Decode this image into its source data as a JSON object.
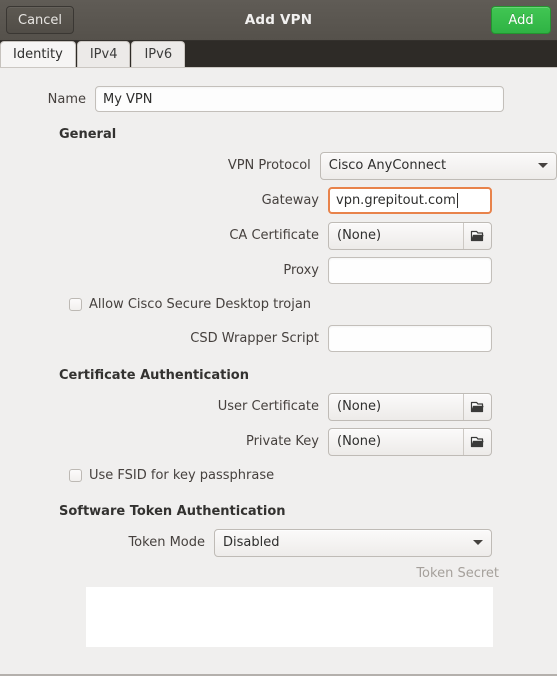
{
  "header": {
    "title": "Add VPN",
    "cancel_label": "Cancel",
    "add_label": "Add"
  },
  "tabs": [
    {
      "label": "Identity",
      "active": true
    },
    {
      "label": "IPv4",
      "active": false
    },
    {
      "label": "IPv6",
      "active": false
    }
  ],
  "form": {
    "name": {
      "label": "Name",
      "value": "My VPN",
      "placeholder": ""
    },
    "general": {
      "title": "General",
      "vpn_protocol": {
        "label": "VPN Protocol",
        "value": "Cisco AnyConnect"
      },
      "gateway": {
        "label": "Gateway",
        "value": "vpn.grepitout.com",
        "placeholder": ""
      },
      "ca_certificate": {
        "label": "CA Certificate",
        "value": "(None)",
        "icon": "open-folder-icon"
      },
      "proxy": {
        "label": "Proxy",
        "value": "",
        "placeholder": ""
      },
      "allow_trojan": {
        "label": "Allow Cisco Secure Desktop trojan",
        "checked": false
      },
      "csd_wrapper_script": {
        "label": "CSD Wrapper Script",
        "value": "",
        "placeholder": ""
      }
    },
    "certificate_authentication": {
      "title": "Certificate Authentication",
      "user_certificate": {
        "label": "User Certificate",
        "value": "(None)",
        "icon": "open-folder-icon"
      },
      "private_key": {
        "label": "Private Key",
        "value": "(None)",
        "icon": "open-folder-icon"
      },
      "use_fsid": {
        "label": "Use FSID for key passphrase",
        "checked": false
      }
    },
    "software_token_authentication": {
      "title": "Software Token Authentication",
      "token_mode": {
        "label": "Token Mode",
        "value": "Disabled"
      },
      "token_secret": {
        "label": "Token Secret",
        "value": "",
        "enabled": false
      }
    }
  },
  "colors": {
    "headerbar": "#57534d",
    "accent_add": "#2fb344",
    "focus_border": "#e8834b",
    "body_bg": "#f0efee"
  }
}
